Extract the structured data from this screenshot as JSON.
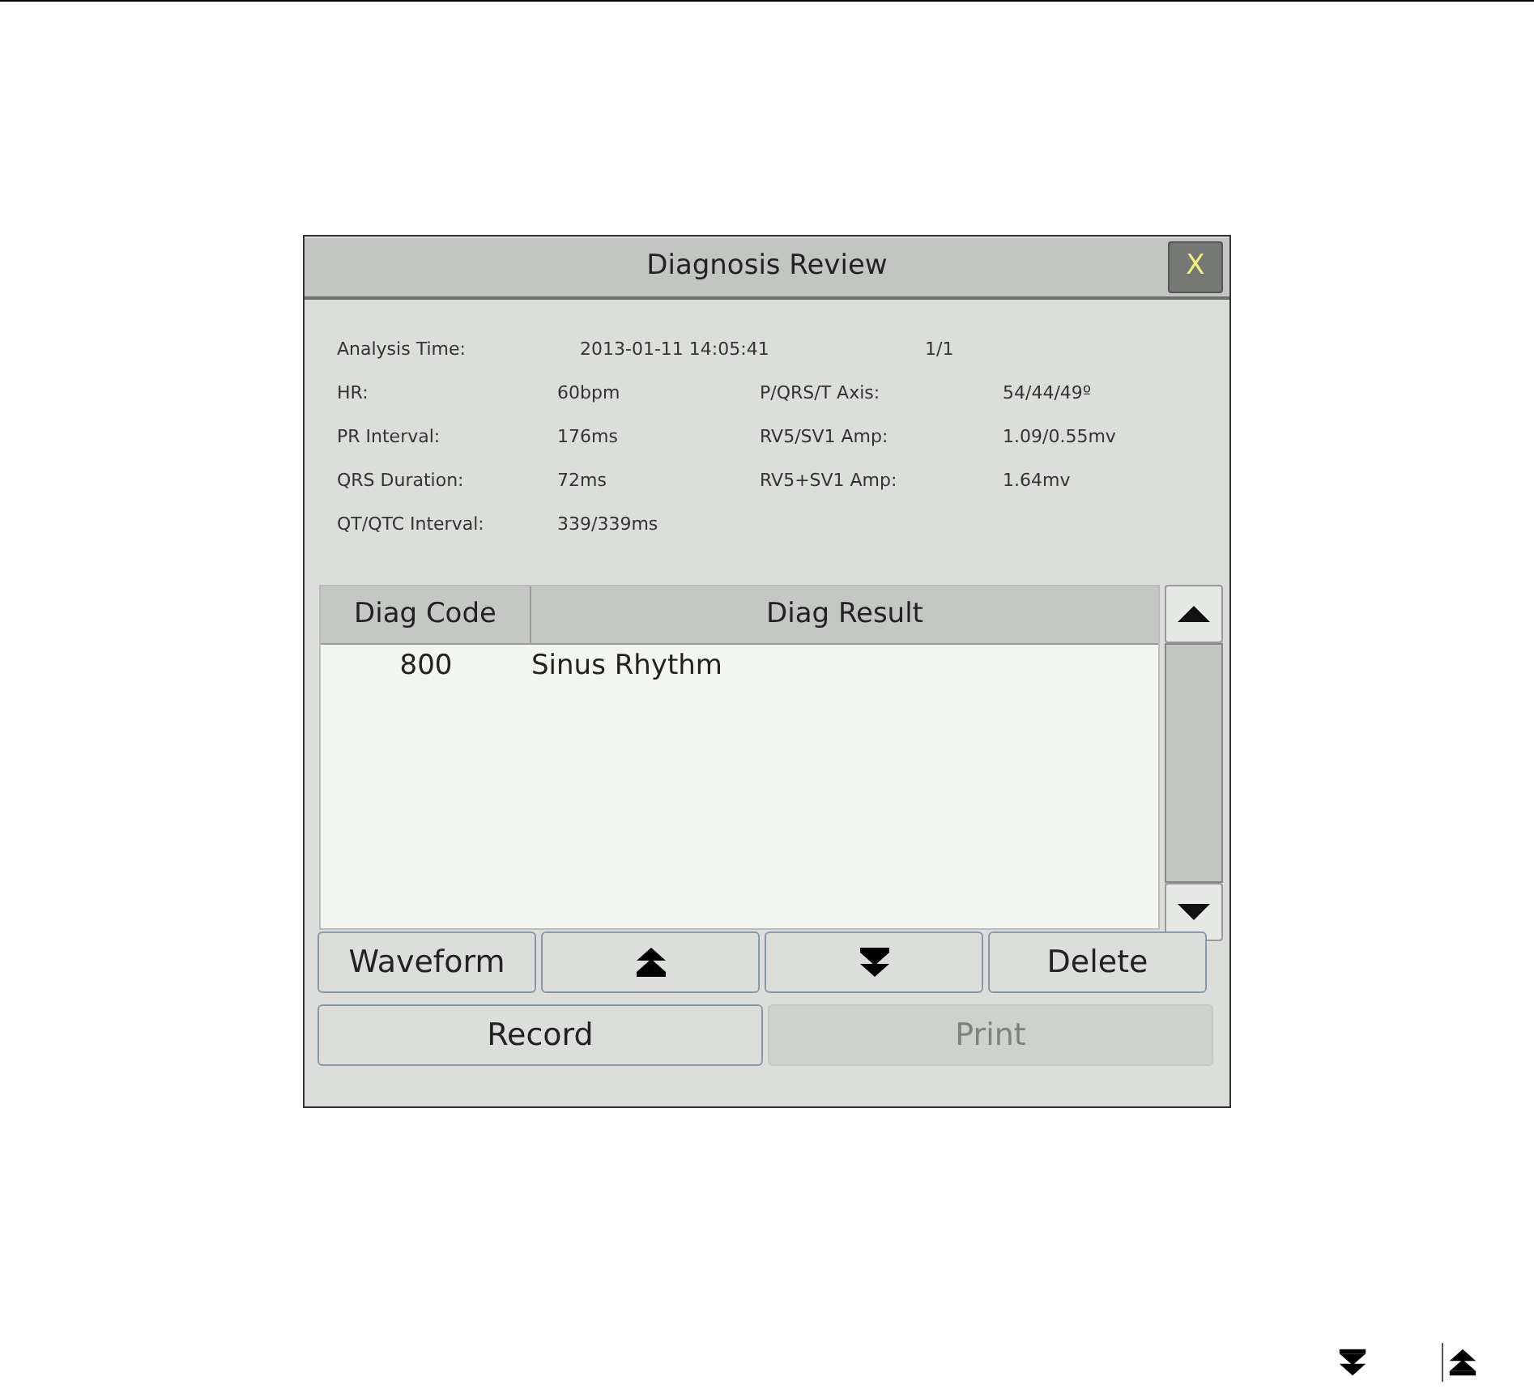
{
  "window": {
    "title": "Diagnosis Review",
    "close": "X"
  },
  "info_rows": [
    {
      "label": "Analysis Time:",
      "value": "2013-01-11 14:05:41",
      "extra": "1/1"
    },
    {
      "label": "HR:",
      "value": "60bpm",
      "label_2": "P/QRS/T Axis:",
      "value_2": "54/44/49º"
    },
    {
      "label": "PR Interval:",
      "value": "176ms",
      "label_2": "RV5/SV1 Amp:",
      "value_2": "1.09/0.55mv"
    },
    {
      "label": "QRS Duration:",
      "value": "72ms",
      "label_2": "RV5+SV1 Amp:",
      "value_2": "1.64mv"
    },
    {
      "label": "QT/QTC Interval:",
      "value": "339/339ms"
    }
  ],
  "table": {
    "columns": [
      "Diag Code",
      "Diag Result"
    ],
    "rows": [
      [
        "800",
        "Sinus Rhythm"
      ]
    ]
  },
  "buttons": [
    {
      "kind": "text",
      "label": "Waveform",
      "disabled": false
    },
    {
      "kind": "page_up",
      "disabled": false
    },
    {
      "kind": "page_down",
      "disabled": false
    },
    {
      "kind": "text",
      "label": "Delete",
      "disabled": false
    }
  ],
  "buttons_2": [
    {
      "kind": "text",
      "label": "Record",
      "disabled": false
    },
    {
      "kind": "text",
      "label": "Print",
      "disabled": true
    }
  ],
  "footer_icons": [
    {
      "kind": "page_down"
    },
    {
      "kind": "page_up"
    }
  ]
}
